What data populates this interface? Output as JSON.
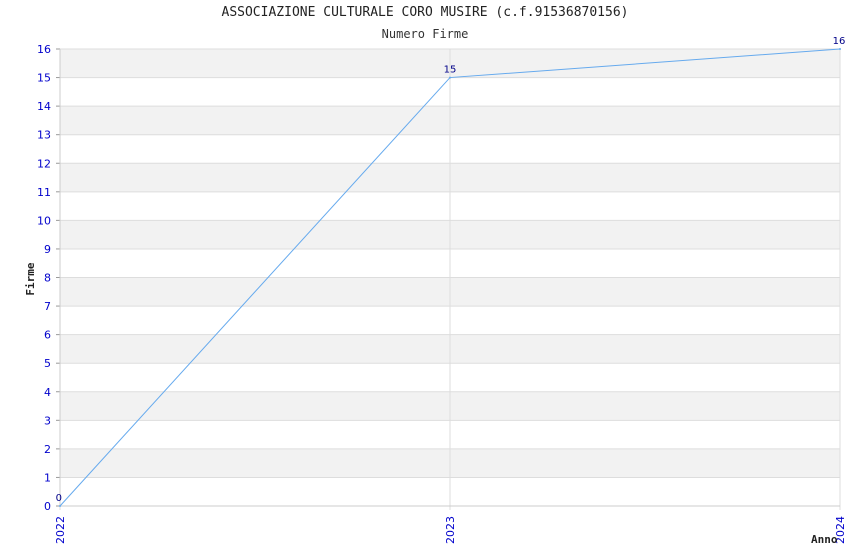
{
  "chart_data": {
    "type": "line",
    "title": "ASSOCIAZIONE CULTURALE CORO MUSIRE (c.f.91536870156)",
    "subtitle": "Numero Firme",
    "xlabel": "Anno",
    "ylabel": "Firme",
    "categories": [
      "2022",
      "2023",
      "2024"
    ],
    "series": [
      {
        "values": [
          0,
          15,
          16
        ],
        "color": "#66aaee"
      }
    ],
    "data_labels": [
      "0",
      "15",
      "16"
    ],
    "ylim": [
      0,
      16
    ],
    "yticks": [
      0,
      1,
      2,
      3,
      4,
      5,
      6,
      7,
      8,
      9,
      10,
      11,
      12,
      13,
      14,
      15,
      16
    ],
    "grid": true,
    "band_colors": [
      "#ffffff",
      "#f2f2f2"
    ],
    "tick_color": "#0000cc"
  }
}
